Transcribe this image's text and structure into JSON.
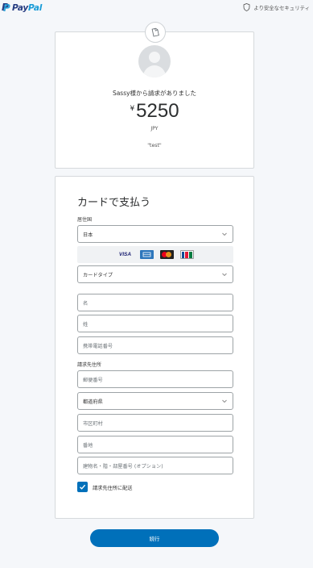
{
  "header": {
    "logo_text_pay": "Pay",
    "logo_text_pal": "Pal",
    "secure_label": "より安全なセキュリティ"
  },
  "request": {
    "message": "Sassy様から請求がありました",
    "currency_symbol": "¥",
    "amount": "5250",
    "currency_code": "JPY",
    "note": "\"test\""
  },
  "form": {
    "title": "カードで支払う",
    "country_label": "居住国",
    "country_value": "日本",
    "card_brands": [
      "VISA",
      "American Express",
      "MasterCard",
      "JCB"
    ],
    "card_type_placeholder": "カードタイプ",
    "first_name_placeholder": "名",
    "last_name_placeholder": "姓",
    "phone_placeholder": "携帯電話番号",
    "billing_label": "請求先住所",
    "postal_placeholder": "郵便番号",
    "prefecture_placeholder": "都道府県",
    "city_placeholder": "市区町村",
    "street_placeholder": "番地",
    "building_placeholder": "建物名・階・部屋番号 (オプション)",
    "ship_to_billing_label": "請求先住所に配送",
    "ship_to_billing_checked": true
  },
  "actions": {
    "continue_label": "続行"
  },
  "colors": {
    "primary": "#0070ba",
    "paypal_dark": "#253b80",
    "paypal_light": "#179bd7"
  }
}
